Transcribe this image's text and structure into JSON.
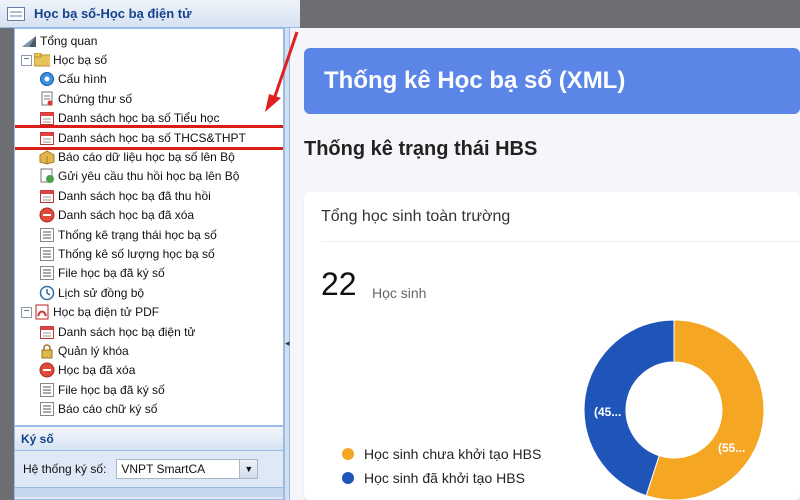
{
  "window": {
    "title": "Học bạ số-Học bạ điện tử"
  },
  "tree": {
    "items": [
      {
        "label": "Tổng quan",
        "level": 0,
        "icon": "chart-icon"
      },
      {
        "label": "Học bạ số",
        "level": 0,
        "icon": "folder-icon",
        "expander": "−"
      },
      {
        "label": "Cấu hình",
        "level": 1,
        "icon": "gear-icon"
      },
      {
        "label": "Chứng thư số",
        "level": 1,
        "icon": "certificate-icon"
      },
      {
        "label": "Danh sách học bạ số Tiểu học",
        "level": 1,
        "icon": "calendar-icon"
      },
      {
        "label": "Danh sách học bạ số THCS&THPT",
        "level": 1,
        "icon": "calendar-icon",
        "highlight": true
      },
      {
        "label": "Báo cáo dữ liệu học bạ số lên Bộ",
        "level": 1,
        "icon": "package-icon"
      },
      {
        "label": "Gửi yêu cầu thu hồi học bạ lên Bộ",
        "level": 1,
        "icon": "refresh-doc-icon"
      },
      {
        "label": "Danh sách học bạ đã thu hồi",
        "level": 1,
        "icon": "calendar-icon"
      },
      {
        "label": "Danh sách học bạ đã xóa",
        "level": 1,
        "icon": "delete-icon"
      },
      {
        "label": "Thống kê trạng thái học bạ số",
        "level": 1,
        "icon": "list-icon"
      },
      {
        "label": "Thống kê số lượng học bạ số",
        "level": 1,
        "icon": "list-icon"
      },
      {
        "label": "File học bạ đã ký số",
        "level": 1,
        "icon": "list-icon"
      },
      {
        "label": "Lịch sử đồng bộ",
        "level": 1,
        "icon": "history-icon"
      },
      {
        "label": "Học bạ điện tử PDF",
        "level": 0,
        "icon": "pdf-icon",
        "expander": "−"
      },
      {
        "label": "Danh sách học bạ điện tử",
        "level": 1,
        "icon": "calendar-icon"
      },
      {
        "label": "Quản lý khóa",
        "level": 1,
        "icon": "lock-icon"
      },
      {
        "label": "Học bạ đã xóa",
        "level": 1,
        "icon": "delete-icon"
      },
      {
        "label": "File học bạ đã ký số",
        "level": 1,
        "icon": "list-icon"
      },
      {
        "label": "Báo cáo chữ ký số",
        "level": 1,
        "icon": "list-icon"
      }
    ]
  },
  "signing": {
    "header": "Ký số",
    "system_label": "Hệ thống ký số:",
    "system_value": "VNPT SmartCA"
  },
  "dashboard": {
    "banner": "Thống kê Học bạ số (XML)",
    "subtitle": "Thống kê trạng thái HBS",
    "card_title": "Tổng học sinh toàn trường",
    "total": "22",
    "total_unit": "Học sinh",
    "slice_label_blue": "(45...",
    "slice_label_orange": "(55..."
  },
  "chart_data": {
    "type": "pie",
    "categories": [
      "Học sinh chưa khởi tạo HBS",
      "Học sinh đã khởi tạo HBS"
    ],
    "values": [
      55,
      45
    ],
    "colors": [
      "#f5a623",
      "#1f55b8"
    ],
    "legend": "bottom-left"
  }
}
